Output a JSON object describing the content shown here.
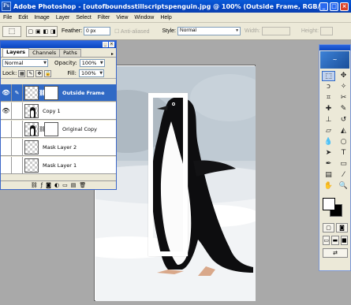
{
  "app": {
    "title": "Adobe Photoshop - [outofboundsstillscriptspenguin.jpg @ 100% (Outside Frame, RGB/8#)]",
    "icon_text": "Ps"
  },
  "window_controls": {
    "minimize": "_",
    "maximize": "□",
    "close": "×"
  },
  "menu": [
    "File",
    "Edit",
    "Image",
    "Layer",
    "Select",
    "Filter",
    "View",
    "Window",
    "Help"
  ],
  "options_bar": {
    "feather_label": "Feather:",
    "feather_value": "0 px",
    "anti_aliased_label": "Anti-aliased",
    "style_label": "Style:",
    "style_value": "Normal",
    "width_label": "Width:",
    "height_label": "Height:"
  },
  "layers_panel": {
    "tabs": [
      "Layers",
      "Channels",
      "Paths"
    ],
    "blend_mode": "Normal",
    "opacity_label": "Opacity:",
    "opacity_value": "100%",
    "lock_label": "Lock:",
    "fill_label": "Fill:",
    "fill_value": "100%",
    "layers": [
      {
        "name": "Outside Frame",
        "visible": true,
        "selected": true
      },
      {
        "name": "Copy 1",
        "visible": true,
        "selected": false
      },
      {
        "name": "Original Copy",
        "visible": false,
        "selected": false
      },
      {
        "name": "Mask Layer 2",
        "visible": false,
        "selected": false
      },
      {
        "name": "Mask Layer 1",
        "visible": false,
        "selected": false
      }
    ]
  },
  "colors": {
    "title_bar": "#0a5bd8",
    "selection": "#316ac5",
    "panel_bg": "#ece9d8",
    "workspace": "#a9a9a9",
    "foreground": "#ffffff",
    "background": "#000000"
  }
}
